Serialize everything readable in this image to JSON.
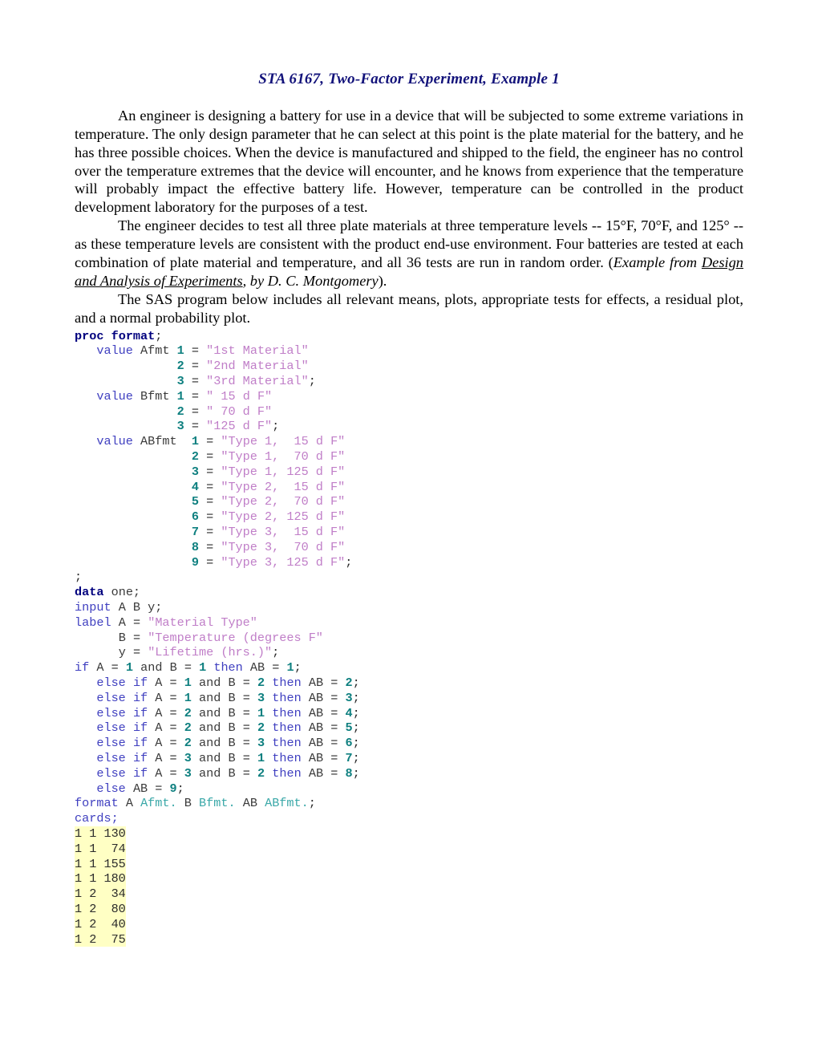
{
  "document": {
    "title": "STA 6167, Two-Factor Experiment, Example 1",
    "title_color": "#12127a",
    "background": "#ffffff",
    "highlight_color": "#ffffc4"
  },
  "paragraphs": {
    "p1_a": "An engineer is designing a battery for use in a device that will be subjected to some extreme variations in temperature.  The only design parameter that he can select at this point is the plate material for the battery, and he has three possible choices.  When the device is manufactured and shipped to the field, the engineer has no control over the temperature extremes that the device will encounter, and he knows from experience that the temperature will probably impact the effective battery life.  However, temperature can be controlled in the product development laboratory for the purposes of a test.",
    "p2_a": "The engineer decides to test all three plate materials at three temperature levels -- 15°F, 70°F, and 125° -- as these temperature levels are consistent with the product end-use environment.  Four batteries are tested at each combination of plate material and temperature, and all 36 tests are run in random order.  (",
    "p2_italic_1": "Example from ",
    "p2_underline": "Design and Analysis of Experiments",
    "p2_italic_2": ", by D. C. Montgomery",
    "p2_tail": ").",
    "p3": "The SAS program below includes all relevant means, plots, appropriate tests for effects, a residual plot, and a normal probability plot."
  },
  "code": {
    "proc_format": {
      "kw_proc": "proc",
      "kw_format": "format",
      "semi": ";"
    },
    "afmt": {
      "kw_value": "value",
      "name": "Afmt",
      "entries": [
        {
          "num": "1",
          "eq": "=",
          "str": "\"1st Material\"",
          "end": ""
        },
        {
          "num": "2",
          "eq": "=",
          "str": "\"2nd Material\"",
          "end": ""
        },
        {
          "num": "3",
          "eq": "=",
          "str": "\"3rd Material\"",
          "end": ";"
        }
      ]
    },
    "bfmt": {
      "kw_value": "value",
      "name": "Bfmt",
      "entries": [
        {
          "num": "1",
          "eq": "=",
          "str": "\" 15 d F\"",
          "end": ""
        },
        {
          "num": "2",
          "eq": "=",
          "str": "\" 70 d F\"",
          "end": ""
        },
        {
          "num": "3",
          "eq": "=",
          "str": "\"125 d F\"",
          "end": ";"
        }
      ]
    },
    "abfmt": {
      "kw_value": "value",
      "name": "ABfmt",
      "entries": [
        {
          "num": "1",
          "eq": "=",
          "str": "\"Type 1,  15 d F\"",
          "end": ""
        },
        {
          "num": "2",
          "eq": "=",
          "str": "\"Type 1,  70 d F\"",
          "end": ""
        },
        {
          "num": "3",
          "eq": "=",
          "str": "\"Type 1, 125 d F\"",
          "end": ""
        },
        {
          "num": "4",
          "eq": "=",
          "str": "\"Type 2,  15 d F\"",
          "end": ""
        },
        {
          "num": "5",
          "eq": "=",
          "str": "\"Type 2,  70 d F\"",
          "end": ""
        },
        {
          "num": "6",
          "eq": "=",
          "str": "\"Type 2, 125 d F\"",
          "end": ""
        },
        {
          "num": "7",
          "eq": "=",
          "str": "\"Type 3,  15 d F\"",
          "end": ""
        },
        {
          "num": "8",
          "eq": "=",
          "str": "\"Type 3,  70 d F\"",
          "end": ""
        },
        {
          "num": "9",
          "eq": "=",
          "str": "\"Type 3, 125 d F\"",
          "end": ";"
        }
      ]
    },
    "lone_semicolon": ";",
    "data_step": {
      "kw_data": "data",
      "dataset": "one;",
      "kw_input": "input",
      "input_vars": "A B y;",
      "kw_label": "label",
      "labels": [
        {
          "var": "A",
          "eq": "=",
          "str": "\"Material Type\"",
          "end": ""
        },
        {
          "var": "B",
          "eq": "=",
          "str": "\"Temperature (degrees F\"",
          "end": ""
        },
        {
          "var": "y",
          "eq": "=",
          "str": "\"Lifetime (hrs.)\"",
          "end": ";"
        }
      ]
    },
    "if_block": {
      "first": {
        "kw_if": "if",
        "lhs": "A",
        "eq1": "=",
        "a": "1",
        "and": "and",
        "rhs": "B",
        "eq2": "=",
        "b": "1",
        "kw_then": "then",
        "assign": "AB",
        "eq3": "=",
        "ab": "1",
        "semi": ";"
      },
      "kw_else": "else",
      "kw_if": "if",
      "kw_and": "and",
      "kw_then": "then",
      "rows": [
        {
          "a": "1",
          "b": "2",
          "ab": "2"
        },
        {
          "a": "1",
          "b": "3",
          "ab": "3"
        },
        {
          "a": "2",
          "b": "1",
          "ab": "4"
        },
        {
          "a": "2",
          "b": "2",
          "ab": "5"
        },
        {
          "a": "2",
          "b": "3",
          "ab": "6"
        },
        {
          "a": "3",
          "b": "1",
          "ab": "7"
        },
        {
          "a": "3",
          "b": "2",
          "ab": "8"
        }
      ],
      "final": {
        "kw_else": "else",
        "assign": "AB",
        "eq": "=",
        "ab": "9",
        "semi": ";"
      }
    },
    "format_stmt": {
      "kw_format": "format",
      "v1": "A",
      "f1": "Afmt.",
      "v2": "B",
      "f2": "Bfmt.",
      "v3": "AB",
      "f3": "ABfmt.",
      "semi": ";"
    },
    "cards_stmt": "cards;",
    "cards_rows": [
      "1 1 130",
      "1 1  74",
      "1 1 155",
      "1 1 180",
      "1 2  34",
      "1 2  80",
      "1 2  40",
      "1 2  75"
    ]
  }
}
